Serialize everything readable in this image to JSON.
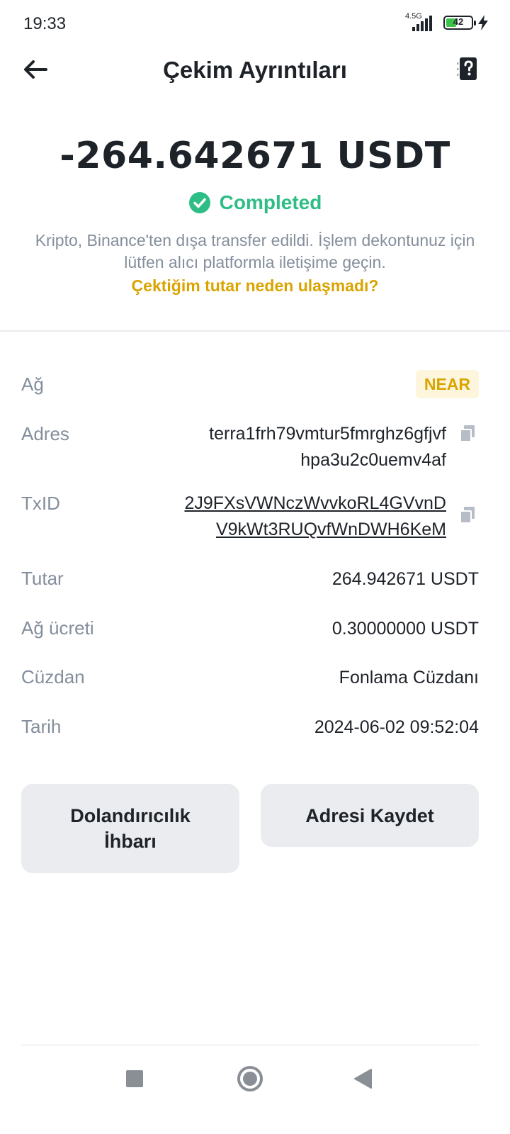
{
  "status_bar": {
    "time": "19:33",
    "network": "4.5G",
    "battery": "42",
    "battery_level": 0.42,
    "icons": [
      "signal-icon",
      "battery-icon",
      "charging-bolt-icon"
    ]
  },
  "header": {
    "title": "Çekim Ayrıntıları",
    "back_icon": "arrow-left-icon",
    "help_icon": "help-document-icon"
  },
  "summary": {
    "amount": "-264.642671 USDT",
    "status": "Completed",
    "status_color": "#2ebd85",
    "status_icon": "check-circle-icon",
    "note": "Kripto, Binance'ten dışa transfer edildi. İşlem dekontunuz için lütfen alıcı platformla iletişime geçin.",
    "help_link": "Çektiğim tutar neden ulaşmadı?",
    "link_color": "#d9a400"
  },
  "details": {
    "network_label": "Ağ",
    "network_value": "NEAR",
    "address_label": "Adres",
    "address_line1": "terra1frh79vmtur5fmrghz6gfjvf",
    "address_line2": "hpa3u2c0uemv4af",
    "txid_label": "TxID",
    "txid_line1": "2J9FXsVWNczWvvkoRL4GVvnD",
    "txid_line2": "V9kWt3RUQvfWnDWH6KeM",
    "amount_label": "Tutar",
    "amount_value": "264.942671 USDT",
    "fee_label": "Ağ ücreti",
    "fee_value": "0.30000000 USDT",
    "wallet_label": "Cüzdan",
    "wallet_value": "Fonlama Cüzdanı",
    "date_label": "Tarih",
    "date_value": "2024-06-02 09:52:04",
    "copy_icon": "copy-icon"
  },
  "actions": {
    "fraud_line1": "Dolandırıcılık",
    "fraud_line2": "İhbarı",
    "save_address": "Adresi Kaydet"
  },
  "nav_bar": {
    "icons": [
      "recents-square-icon",
      "home-circle-icon",
      "back-triangle-icon"
    ]
  }
}
